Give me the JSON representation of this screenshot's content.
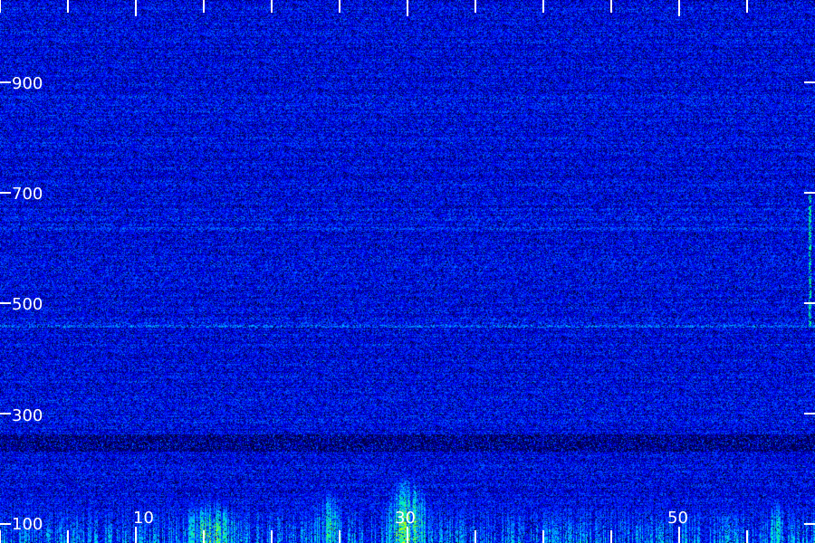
{
  "chart_data": {
    "type": "heatmap",
    "title": "",
    "xlabel": "",
    "ylabel": "",
    "xlim": [
      -5,
      57
    ],
    "ylim": [
      100,
      1100
    ],
    "x_tick_labels": [
      "10",
      "30",
      "50"
    ],
    "y_tick_labels": [
      "100",
      "300",
      "500",
      "700",
      "900"
    ],
    "x_ticks": [
      0,
      5,
      10,
      15,
      20,
      25,
      30,
      35,
      40,
      45,
      50,
      55
    ],
    "y_ticks": [
      100,
      300,
      500,
      700,
      900
    ],
    "x_labeled_ticks": [
      10,
      30,
      50
    ],
    "colormap": [
      "#000000",
      "#000080",
      "#0000ff",
      "#0080ff",
      "#00e0ff",
      "#00ff80",
      "#c8ff00"
    ],
    "background_intensity": 0.35,
    "features": [
      {
        "kind": "band",
        "y_range": [
          100,
          240
        ],
        "intensity": 0.75
      },
      {
        "kind": "blob",
        "x": 11,
        "y": 110,
        "x_width": 7,
        "y_height": 90,
        "intensity": 0.95
      },
      {
        "kind": "blob",
        "x": 26,
        "y": 115,
        "x_width": 5,
        "y_height": 140,
        "intensity": 1.0
      },
      {
        "kind": "blob",
        "x": 20,
        "y": 120,
        "x_width": 4,
        "y_height": 100,
        "intensity": 0.85
      },
      {
        "kind": "blob",
        "x": 54,
        "y": 120,
        "x_width": 2,
        "y_height": 80,
        "intensity": 0.8
      },
      {
        "kind": "dark_band",
        "y_range": [
          270,
          300
        ],
        "intensity": 0.05
      },
      {
        "kind": "line",
        "y": 500,
        "intensity": 0.65
      },
      {
        "kind": "line",
        "y": 680,
        "intensity": 0.55
      },
      {
        "kind": "vline",
        "x": 56.6,
        "y_range": [
          500,
          740
        ],
        "intensity": 0.8
      }
    ]
  }
}
